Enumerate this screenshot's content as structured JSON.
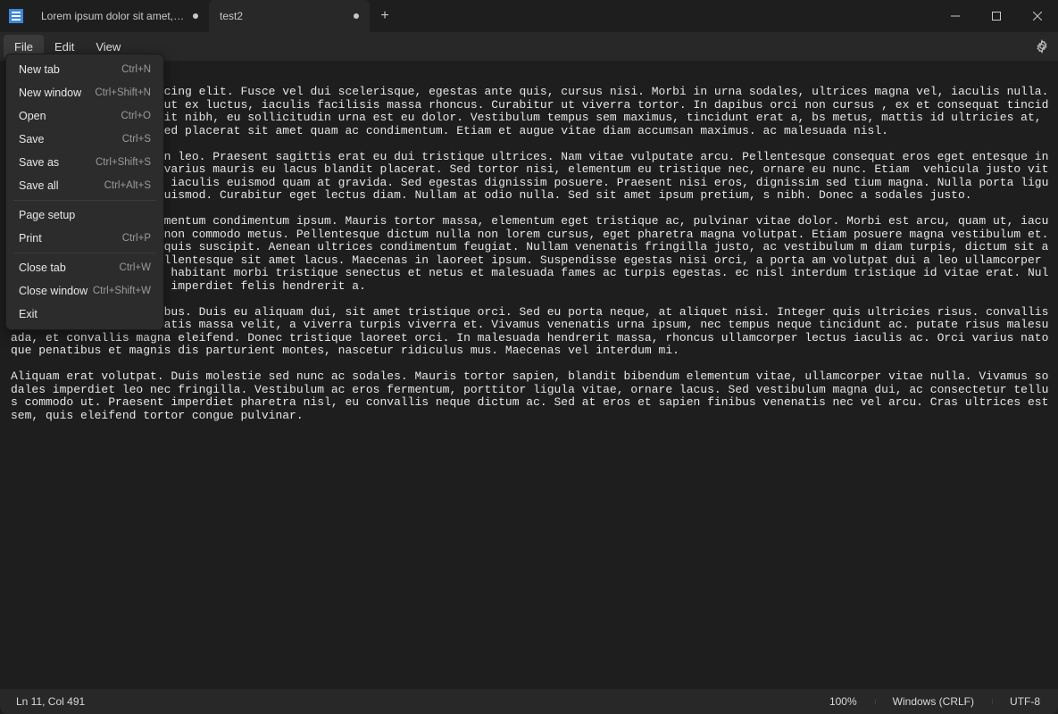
{
  "tabs": [
    {
      "title": "Lorem ipsum dolor sit amet, consect",
      "dirty": true
    },
    {
      "title": "test2",
      "dirty": true
    }
  ],
  "menubar": {
    "file": "File",
    "edit": "Edit",
    "view": "View"
  },
  "file_menu": {
    "new_tab": {
      "label": "New tab",
      "shortcut": "Ctrl+N"
    },
    "new_window": {
      "label": "New window",
      "shortcut": "Ctrl+Shift+N"
    },
    "open": {
      "label": "Open",
      "shortcut": "Ctrl+O"
    },
    "save": {
      "label": "Save",
      "shortcut": "Ctrl+S"
    },
    "save_as": {
      "label": "Save as",
      "shortcut": "Ctrl+Shift+S"
    },
    "save_all": {
      "label": "Save all",
      "shortcut": "Ctrl+Alt+S"
    },
    "page_setup": {
      "label": "Page setup",
      "shortcut": ""
    },
    "print": {
      "label": "Print",
      "shortcut": "Ctrl+P"
    },
    "close_tab": {
      "label": "Close tab",
      "shortcut": "Ctrl+W"
    },
    "close_window": {
      "label": "Close window",
      "shortcut": "Ctrl+Shift+W"
    },
    "exit": {
      "label": "Exit",
      "shortcut": ""
    }
  },
  "editor_text": "et, consectetur adipiscing elit. Fusce vel dui scelerisque, egestas ante quis, cursus nisi. Morbi in urna sodales, ultrices magna vel, iaculis nulla. Vivamus ultricies dui ut ex luctus, iaculis facilisis massa rhoncus. Curabitur ut viverra tortor. In dapibus orci non cursus , ex et consequat tincidunt, urna diam hendrerit nibh, eu sollicitudin urna est eu dolor. Vestibulum tempus sem maximus, tincidunt erat a, bs metus, mattis id ultricies at, molestie eget dolor. Sed placerat sit amet quam ac condimentum. Etiam et augue vitae diam accumsan maximus. ac malesuada nisl.\n\n ultricies blandit a in leo. Praesent sagittis erat eu dui tristique ultrices. Nam vitae vulputate arcu. Pellentesque consequat eros eget entesque in odio arcu. Vestibulum varius mauris eu lacus blandit placerat. Sed tortor nisi, elementum eu tristique nec, ornare eu nunc. Etiam  vehicula justo vitae, mollis elit. Proin iaculis euismod quam at gravida. Sed egestas dignissim posuere. Praesent nisi eros, dignissim sed tium magna. Nulla porta ligula sed nisl lobortis euismod. Curabitur eget lectus diam. Nullam at odio nulla. Sed sit amet ipsum pretium, s nibh. Donec a sodales justo.\n\nor at orci eget, condimentum condimentum ipsum. Mauris tortor massa, elementum eget tristique ac, pulvinar vitae dolor. Morbi est arcu, quam ut, iaculis a nibh. Curabitur non commodo metus. Pellentesque dictum nulla non lorem cursus, eget pharetra magna volutpat. Etiam posuere magna vestibulum et. Nam sagittis eu purus quis suscipit. Aenean ultrices condimentum feugiat. Nullam venenatis fringilla justo, ac vestibulum m diam turpis, dictum sit amet vulputate quis, pellentesque sit amet lacus. Maecenas in laoreet ipsum. Suspendisse egestas nisi orci, a porta am volutpat dui a leo ullamcorper placerat. Pellentesque habitant morbi tristique senectus et netus et malesuada fames ac turpis egestas. ec nisl interdum tristique id vitae erat. Nullam varius mi nisl, id imperdiet felis hendrerit a.\n\nae leo vulputate faucibus. Duis eu aliquam dui, sit amet tristique orci. Sed eu porta neque, at aliquet nisi. Integer quis ultricies risus. convallis tristique. Donec venenatis massa velit, a viverra turpis viverra et. Vivamus venenatis urna ipsum, nec tempus neque tincidunt ac. putate risus malesuada, et convallis magna eleifend. Donec tristique laoreet orci. In malesuada hendrerit massa, rhoncus ullamcorper lectus iaculis ac. Orci varius natoque penatibus et magnis dis parturient montes, nascetur ridiculus mus. Maecenas vel interdum mi.\n\nAliquam erat volutpat. Duis molestie sed nunc ac sodales. Mauris tortor sapien, blandit bibendum elementum vitae, ullamcorper vitae nulla. Vivamus sodales imperdiet leo nec fringilla. Vestibulum ac eros fermentum, porttitor ligula vitae, ornare lacus. Sed vestibulum magna dui, ac consectetur tellus commodo ut. Praesent imperdiet pharetra nisl, eu convallis neque dictum ac. Sed at eros et sapien finibus venenatis nec vel arcu. Cras ultrices est sem, quis eleifend tortor congue pulvinar.",
  "statusbar": {
    "position": "Ln 11, Col 491",
    "zoom": "100%",
    "line_ending": "Windows (CRLF)",
    "encoding": "UTF-8"
  }
}
